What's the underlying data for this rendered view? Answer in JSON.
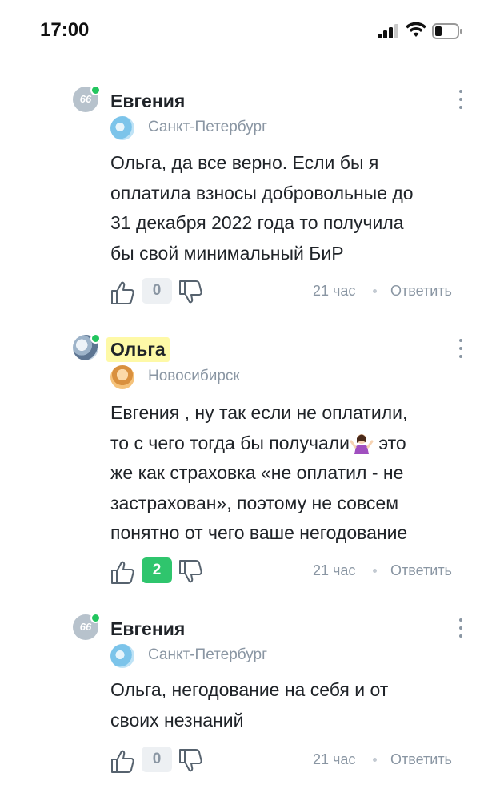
{
  "status_bar": {
    "time": "17:00",
    "icons": [
      "cellular-signal-icon",
      "wifi-icon",
      "battery-icon"
    ]
  },
  "comments": [
    {
      "author": "Евгения",
      "avatar": "avatar-66-gray",
      "online": true,
      "city_icon": "spb-city-icon",
      "city": "Санкт-Петербург",
      "lines": [
        "Ольга, да все верно. Если бы я",
        "оплатила взносы добровольные до",
        "31 декабря 2022 года то получила",
        "бы свой минимальный БиР"
      ],
      "score": "0",
      "time": "21 час",
      "reply": "Ответить"
    },
    {
      "author": "Ольга",
      "avatar": "avatar-photo",
      "online": true,
      "author_highlighted": true,
      "city_icon": "nsk-city-icon",
      "city": "Новосибирск",
      "lines": [
        "Евгения , ну так если не оплатили,",
        "то с чего тогда бы получали",
        "же как страховка «не оплатил - не",
        "застрахован», поэтому не совсем",
        "понятно от чего ваше негодование"
      ],
      "line2_tail": "это",
      "emoji": "shrug-emoji",
      "score": "2",
      "time": "21 час",
      "reply": "Ответить"
    },
    {
      "author": "Евгения",
      "avatar": "avatar-66-gray",
      "online": true,
      "city_icon": "spb-city-icon",
      "city": "Санкт-Петербург",
      "lines": [
        "Ольга, негодование на себя и от",
        "своих незнаний"
      ],
      "score": "0",
      "time": "21 час",
      "reply": "Ответить"
    }
  ],
  "avatar_text": "66",
  "colors": {
    "positive_score": "#2fc56d",
    "online": "#22c55e",
    "highlight": "#fef9a7",
    "muted": "#8a96a3"
  }
}
